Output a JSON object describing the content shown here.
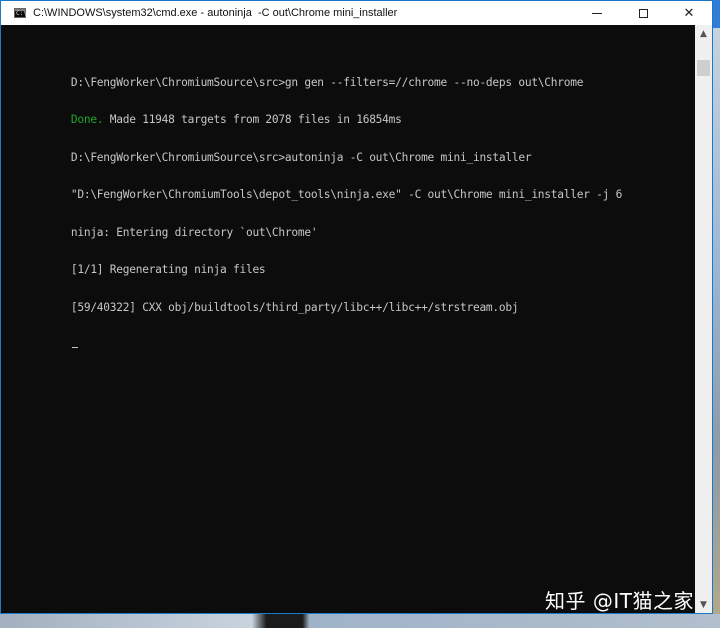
{
  "window": {
    "title": "C:\\WINDOWS\\system32\\cmd.exe - autoninja  -C out\\Chrome mini_installer",
    "app_icon_text": "C:\\",
    "controls": {
      "minimize_icon": "minimize-icon",
      "maximize_icon": "maximize-icon",
      "close_icon": "close-icon",
      "close_glyph": "✕"
    }
  },
  "console": {
    "lines": [
      {
        "text": "D:\\FengWorker\\ChromiumSource\\src>gn gen --filters=//chrome --no-deps out\\Chrome"
      },
      {
        "prefix": "Done.",
        "text": " Made 11948 targets from 2078 files in 16854ms"
      },
      {
        "text": "D:\\FengWorker\\ChromiumSource\\src>autoninja -C out\\Chrome mini_installer"
      },
      {
        "text": "\"D:\\FengWorker\\ChromiumTools\\depot_tools\\ninja.exe\" -C out\\Chrome mini_installer -j 6"
      },
      {
        "text": "ninja: Entering directory `out\\Chrome'"
      },
      {
        "text": "[1/1] Regenerating ninja files"
      },
      {
        "text": "[59/40322] CXX obj/buildtools/third_party/libc++/libc++/strstream.obj"
      }
    ],
    "colors": {
      "text": "#c6c6c6",
      "done": "#1fa52b",
      "background": "#0c0c0c"
    }
  },
  "scrollbar": {
    "up_glyph": "▲",
    "down_glyph": "▼"
  },
  "watermark": {
    "text": "知乎 @IT猫之家"
  }
}
